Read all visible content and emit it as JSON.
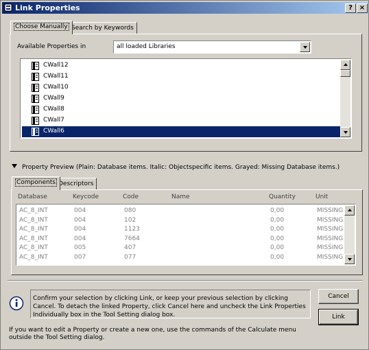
{
  "window": {
    "title": "Link Properties",
    "help_label": "?",
    "close_label": "×"
  },
  "tabs_top": [
    "Choose Manually",
    "Search by Keywords"
  ],
  "available": {
    "label": "Available Properties in",
    "selected": "all loaded Libraries"
  },
  "libraries": [
    {
      "name": "CWall12",
      "selected": false
    },
    {
      "name": "CWall11",
      "selected": false
    },
    {
      "name": "CWall10",
      "selected": false
    },
    {
      "name": "CWall9",
      "selected": false
    },
    {
      "name": "CWall8",
      "selected": false
    },
    {
      "name": "CWall7",
      "selected": false
    },
    {
      "name": "CWall6",
      "selected": true
    }
  ],
  "preview": {
    "label": "Property Preview (Plain: Database items. Italic: Objectspecific items. Grayed: Missing Database items.)"
  },
  "tabs_bottom": [
    "Components",
    "Descriptors"
  ],
  "components": {
    "columns": [
      "Database",
      "Keycode",
      "Code",
      "Name",
      "Quantity",
      "Unit"
    ],
    "rows": [
      [
        "AC_8_INT",
        "004",
        "080",
        "",
        "0,00",
        "MISSING"
      ],
      [
        "AC_8_INT",
        "004",
        "102",
        "",
        "0,00",
        "MISSING"
      ],
      [
        "AC_8_INT",
        "004",
        "1123",
        "",
        "0,00",
        "MISSING"
      ],
      [
        "AC_8_INT",
        "004",
        "7664",
        "",
        "0,00",
        "MISSING"
      ],
      [
        "AC_8_INT",
        "005",
        "407",
        "",
        "0,00",
        "MISSING"
      ],
      [
        "AC_8_INT",
        "007",
        "077",
        "",
        "0,00",
        "MISSING"
      ]
    ]
  },
  "info": {
    "message": "Confirm your selection by clicking Link, or keep your previous selection by clicking Cancel. To detach the linked Property, click Cancel here and uncheck the Link Properties Individually box in the Tool Setting dialog box.",
    "footnote": "If you want to edit a Property or create a new one, use the commands of the Calculate menu outside the Tool Setting dialog."
  },
  "buttons": {
    "cancel": "Cancel",
    "link": "Link"
  },
  "colors": {
    "selection": "#0a246a",
    "title_start": "#0a246a",
    "title_end": "#a6caf0",
    "face": "#d4d0c8",
    "missing_text": "#808080"
  }
}
